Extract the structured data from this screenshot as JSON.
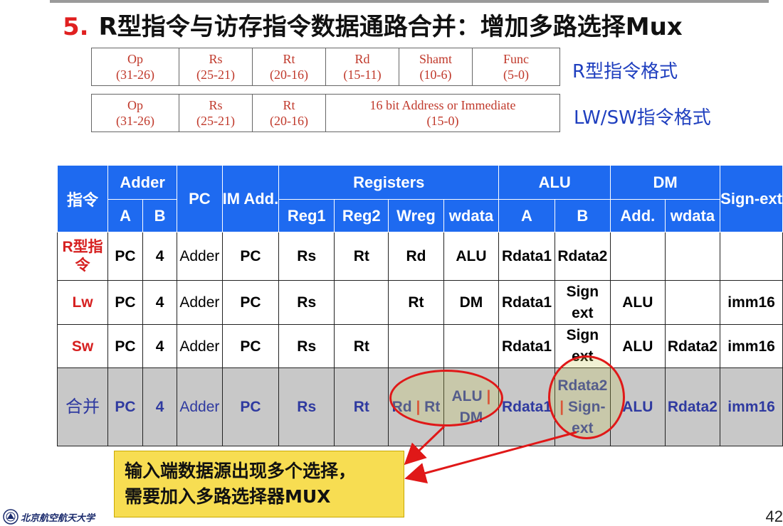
{
  "title": {
    "num": "5.",
    "text": "R型指令与访存指令数据通路合并：增加多路选择Mux"
  },
  "rformat": {
    "label": "R型指令格式",
    "fields": [
      {
        "name": "Op",
        "bits": "(31-26)"
      },
      {
        "name": "Rs",
        "bits": "(25-21)"
      },
      {
        "name": "Rt",
        "bits": "(20-16)"
      },
      {
        "name": "Rd",
        "bits": "(15-11)"
      },
      {
        "name": "Shamt",
        "bits": "(10-6)"
      },
      {
        "name": "Func",
        "bits": "(5-0)"
      }
    ]
  },
  "lwformat": {
    "label": "LW/SW指令格式",
    "fields": [
      {
        "name": "Op",
        "bits": "(31-26)"
      },
      {
        "name": "Rs",
        "bits": "(25-21)"
      },
      {
        "name": "Rt",
        "bits": "(20-16)"
      },
      {
        "name": "16 bit Address or Immediate",
        "bits": "(15-0)"
      }
    ]
  },
  "table": {
    "h1": {
      "instr": "指令",
      "adder": "Adder",
      "pc": "PC",
      "im": "IM Add.",
      "registers": "Registers",
      "alu": "ALU",
      "dm": "DM",
      "signext": "Sign-ext"
    },
    "h2": {
      "adderA": "A",
      "adderB": "B",
      "reg1": "Reg1",
      "reg2": "Reg2",
      "wreg": "Wreg",
      "wdata": "wdata",
      "aluA": "A",
      "aluB": "B",
      "dmAdd": "Add.",
      "dmWdata": "wdata"
    },
    "rows": [
      {
        "name": "R型指令",
        "c": [
          "PC",
          "4",
          "Adder",
          "PC",
          "Rs",
          "Rt",
          "Rd",
          "ALU",
          "Rdata1",
          "Rdata2",
          "",
          "",
          ""
        ]
      },
      {
        "name": "Lw",
        "c": [
          "PC",
          "4",
          "Adder",
          "PC",
          "Rs",
          "",
          "Rt",
          "DM",
          "Rdata1",
          "Sign ext",
          "ALU",
          "",
          "imm16"
        ]
      },
      {
        "name": "Sw",
        "c": [
          "PC",
          "4",
          "Adder",
          "PC",
          "Rs",
          "Rt",
          "",
          "",
          "Rdata1",
          "Sign ext",
          "ALU",
          "Rdata2",
          "imm16"
        ]
      }
    ],
    "merged": {
      "name": "合并",
      "c": [
        "PC",
        "4",
        "Adder",
        "PC",
        "Rs",
        "Rt"
      ],
      "wreg": {
        "a": "Rd",
        "sep": "|",
        "b": "Rt"
      },
      "wdata": {
        "a": "ALU",
        "sep": "|",
        "b": "DM"
      },
      "aluA": "Rdata1",
      "aluB": {
        "a": "Rdata2",
        "sep": "|",
        "b": "Sign-ext"
      },
      "dmAdd": "ALU",
      "dmWdata": "Rdata2",
      "signext": "imm16"
    }
  },
  "note": {
    "line1": "输入端数据源出现多个选择，",
    "line2": "需要加入多路选择器MUX"
  },
  "footer": {
    "school": "北京航空航天大学",
    "page": "42"
  },
  "colors": {
    "header": "#1e6af0",
    "accent": "#e01818",
    "merged_bg": "#c8c8c8",
    "note_bg": "#f7dd52"
  }
}
